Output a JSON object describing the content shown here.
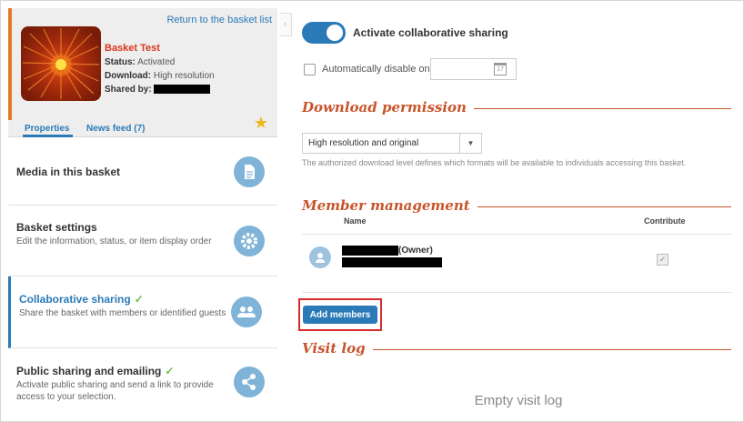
{
  "left": {
    "return_link": "Return to the basket list",
    "basket_title": "Basket Test",
    "status_label": "Status:",
    "status_value": "Activated",
    "download_label": "Download:",
    "download_value": "High resolution",
    "shared_by_label": "Shared by:",
    "tabs": [
      "Properties",
      "News feed (7)"
    ],
    "menu": [
      {
        "title": "Media in this basket",
        "desc": "",
        "icon": "document-icon"
      },
      {
        "title": "Basket settings",
        "desc": "Edit the information, status, or item display order",
        "icon": "gear-icon"
      },
      {
        "title": "Collaborative sharing",
        "desc": "Share the basket with members or identified guests",
        "icon": "people-icon"
      },
      {
        "title": "Public sharing and emailing",
        "desc": "Activate public sharing and send a link to provide access to your selection.",
        "icon": "share-icon"
      }
    ]
  },
  "right": {
    "toggle_label": "Activate collaborative sharing",
    "auto_disable_label": "Automatically disable on",
    "date_value": "",
    "calendar_day": "17",
    "download_section": "Download permission",
    "download_select": "High resolution and original",
    "download_help": "The authorized download level defines which formats will be available to individuals accessing this basket.",
    "member_section": "Member management",
    "col_name": "Name",
    "col_contribute": "Contribute",
    "owner_suffix": "(Owner)",
    "add_members": "Add members",
    "visit_section": "Visit log",
    "empty_visit": "Empty visit log"
  },
  "colors": {
    "accent": "#2a7ab8",
    "section": "#c8552b",
    "highlight": "#d62b2b",
    "check": "#6cbf4a"
  }
}
